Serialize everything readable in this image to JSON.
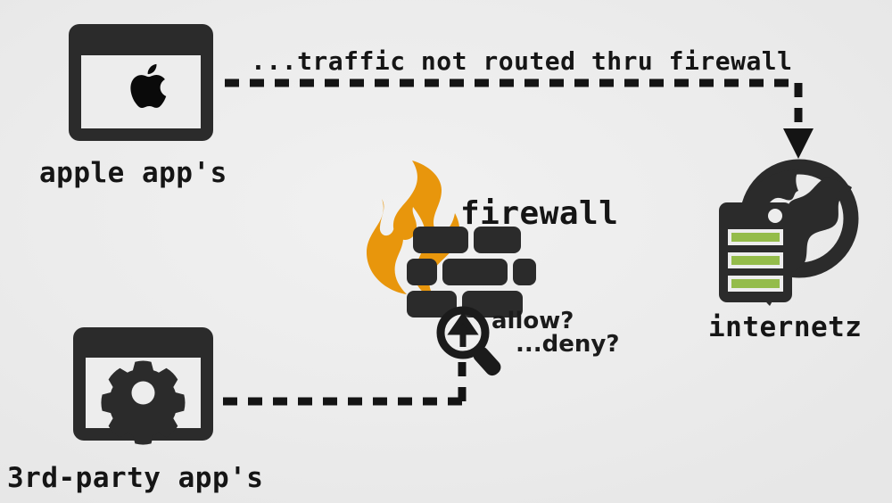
{
  "diagram": {
    "title": "macOS firewall traffic flow diagram",
    "background_color": "#ededed",
    "ink_color": "#2b2b2b",
    "flame_color": "#e8960c",
    "server_led_color": "#94bc4a",
    "nodes": {
      "apple_apps": {
        "label": "apple app's",
        "icon": "apple-window-icon"
      },
      "third_party_apps": {
        "label": "3rd-party app's",
        "icon": "gear-window-icon"
      },
      "firewall": {
        "label": "firewall",
        "icon": "firewall-brick-flame-icon",
        "inspector_icon": "magnifier-uparrow-icon",
        "decision_line_1": "allow?",
        "decision_line_2": "...deny?"
      },
      "internetz": {
        "label": "internetz",
        "icon": "globe-server-icon"
      }
    },
    "edges": {
      "bypass": {
        "label": "...traffic not routed thru firewall",
        "style": "dashed",
        "from": "apple_apps",
        "to": "internetz",
        "arrowhead": "down"
      },
      "inspected": {
        "label": "",
        "style": "dashed",
        "from": "third_party_apps",
        "to": "firewall",
        "arrowhead": "none"
      }
    }
  }
}
